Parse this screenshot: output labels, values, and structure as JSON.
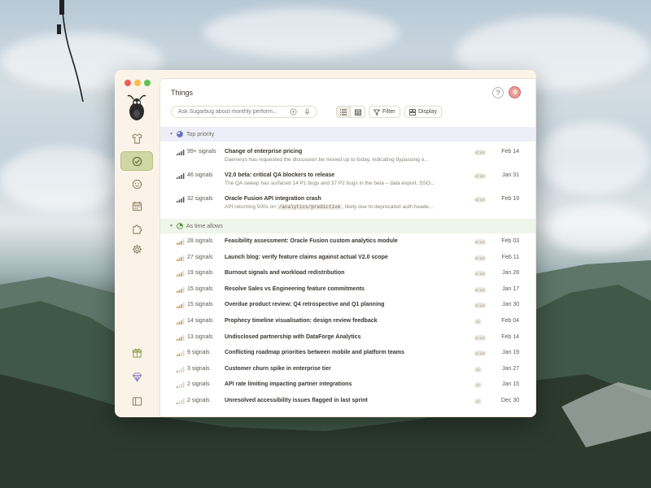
{
  "app": {
    "title": "Things"
  },
  "search": {
    "placeholder": "Ask Sugarbug about monthly perform..."
  },
  "toolbar": {
    "filter_label": "Filter",
    "display_label": "Display"
  },
  "help": {
    "label": "?"
  },
  "colors": {
    "accent": "#cfd7a7",
    "window_bg": "#fbf3e8",
    "top_priority_bg": "#eeeef8",
    "as_time_allows_bg": "#eef5ea"
  },
  "sidebar": {
    "items": [
      {
        "icon": "shirt-icon"
      },
      {
        "icon": "check-circle-icon",
        "active": true
      },
      {
        "icon": "face-icon"
      },
      {
        "icon": "calendar-icon"
      },
      {
        "icon": "puzzle-icon"
      },
      {
        "icon": "gear-icon"
      }
    ],
    "bottom": [
      {
        "icon": "gift-icon"
      },
      {
        "icon": "diamond-icon"
      },
      {
        "icon": "sidebar-toggle-icon"
      }
    ]
  },
  "groups": {
    "top_priority": {
      "label": "Top priority",
      "rows": [
        {
          "signals": "99+ signals",
          "title": "Change of enterprise pricing",
          "desc": "Daenerys has requested the discussion be moved up to today, indicating bypassing o...",
          "pill": "AT MO",
          "date": "Feb 14"
        },
        {
          "signals": "46 signals",
          "title": "V2.0 beta: critical QA blockers to release",
          "desc": "The QA sweep has surfaced 14 P1 bugs and 37 P2 bugs in the beta – data export, SSO...",
          "pill": "AT MO",
          "date": "Jan 31"
        },
        {
          "signals": "32 signals",
          "title": "Oracle Fusion API integration crash",
          "desc_prefix": "API returning 500s on",
          "desc_code": "/analytics/predictive",
          "desc_suffix": ", likely due to deprecated auth heade...",
          "pill": "AT MO",
          "date": "Feb 19"
        }
      ]
    },
    "as_time_allows": {
      "label": "As time allows",
      "rows": [
        {
          "signals": "28 signals",
          "title": "Feasibility assessment: Oracle Fusion custom analytics module",
          "pill": "AT MO",
          "date": "Feb 03"
        },
        {
          "signals": "27 signals",
          "title": "Launch blog: verify feature claims against actual V2.0 scope",
          "pill": "AT MO",
          "date": "Feb 11"
        },
        {
          "signals": "19 signals",
          "title": "Burnout signals and workload redistribution",
          "pill": "AT MO",
          "date": "Jan 28"
        },
        {
          "signals": "15 signals",
          "title": "Resolve Sales vs Engineering feature commitments",
          "pill": "AT MO",
          "date": "Jan 17"
        },
        {
          "signals": "15 signals",
          "title": "Overdue product review: Q4 retrospective and Q1 planning",
          "pill": "AT MO",
          "date": "Jan 30"
        },
        {
          "signals": "14 signals",
          "title": "Prophecy timeline visualisation: design review feedback",
          "pill": "AT",
          "date": "Feb 04"
        },
        {
          "signals": "13 signals",
          "title": "Undisclosed partnership with DataForge Analytics",
          "pill": "AT MO",
          "date": "Feb 14"
        },
        {
          "signals": "9 signals",
          "title": "Conflicting roadmap priorities between mobile and platform teams",
          "pill": "AT MO",
          "date": "Jan 19"
        },
        {
          "signals": "3 signals",
          "title": "Customer churn spike in enterprise tier",
          "pill": "AT",
          "date": "Jan 27"
        },
        {
          "signals": "2 signals",
          "title": "API rate limiting impacting partner integrations",
          "pill": "AT",
          "date": "Jan 15"
        },
        {
          "signals": "2 signals",
          "title": "Unresolved accessibility issues flagged in last sprint",
          "pill": "AT",
          "date": "Dec 30"
        }
      ]
    }
  }
}
